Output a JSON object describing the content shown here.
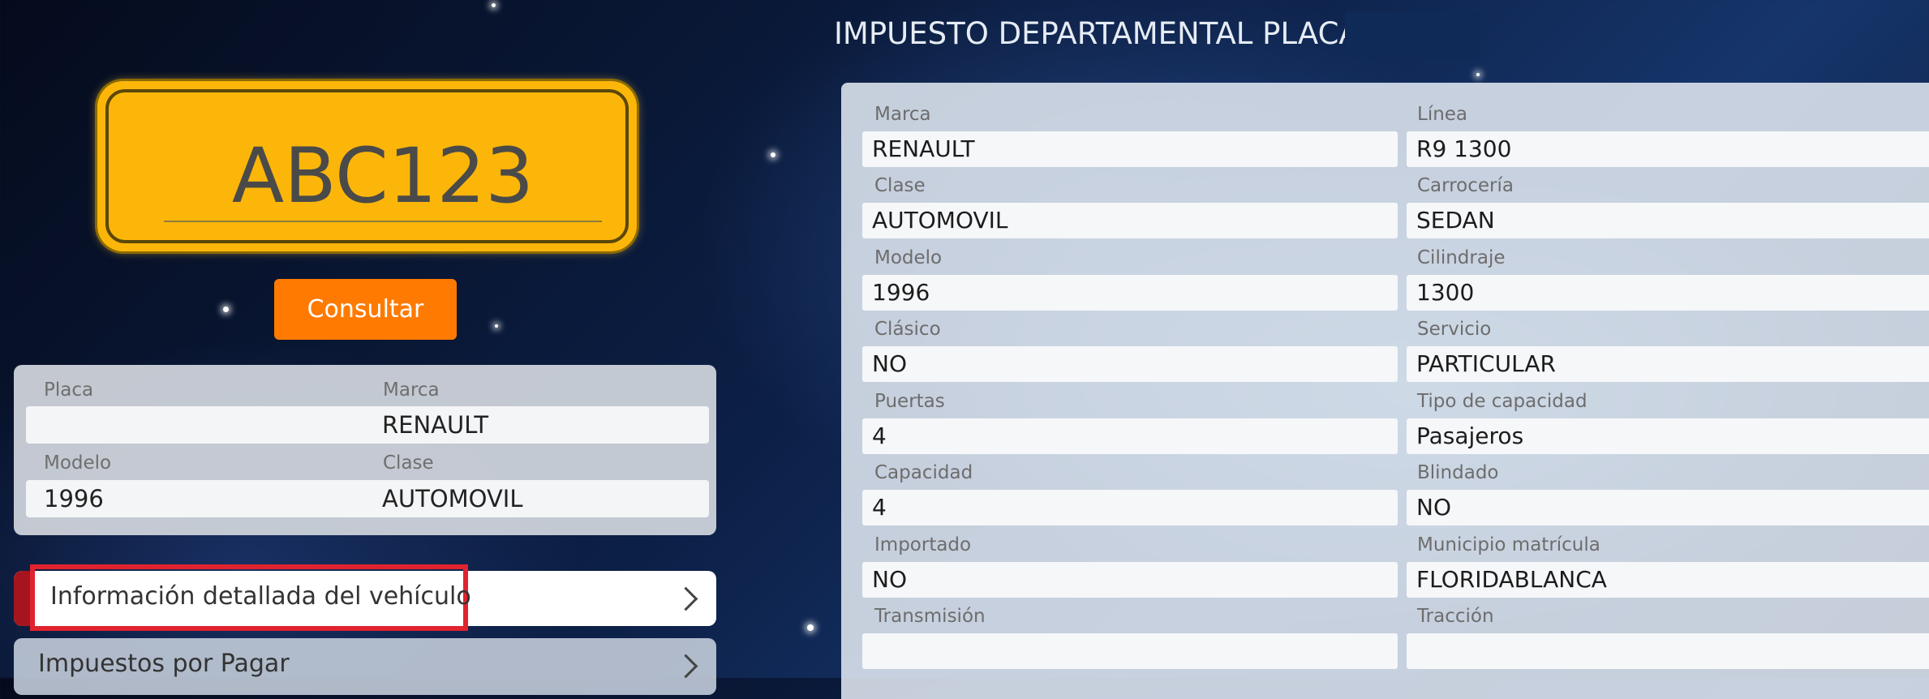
{
  "plate": {
    "value": "ABC123"
  },
  "consultar_label": "Consultar",
  "summary": {
    "placa": {
      "label": "Placa",
      "value": ""
    },
    "marca": {
      "label": "Marca",
      "value": "RENAULT"
    },
    "modelo": {
      "label": "Modelo",
      "value": "1996"
    },
    "clase": {
      "label": "Clase",
      "value": "AUTOMOVIL"
    }
  },
  "accordion": {
    "detailed_info": "Información detallada del vehículo",
    "taxes_due": "Impuestos por Pagar"
  },
  "right_panel": {
    "title": "IMPUESTO DEPARTAMENTAL PLACA",
    "fields": [
      {
        "label": "Marca",
        "value": "RENAULT"
      },
      {
        "label": "Línea",
        "value": "R9 1300"
      },
      {
        "label": "Clase",
        "value": "AUTOMOVIL"
      },
      {
        "label": "Carrocería",
        "value": "SEDAN"
      },
      {
        "label": "Modelo",
        "value": "1996"
      },
      {
        "label": "Cilindraje",
        "value": "1300"
      },
      {
        "label": "Clásico",
        "value": "NO"
      },
      {
        "label": "Servicio",
        "value": "PARTICULAR"
      },
      {
        "label": "Puertas",
        "value": "4"
      },
      {
        "label": "Tipo de capacidad",
        "value": "Pasajeros"
      },
      {
        "label": "Capacidad",
        "value": "4"
      },
      {
        "label": "Blindado",
        "value": "NO"
      },
      {
        "label": "Importado",
        "value": "NO"
      },
      {
        "label": "Municipio matrícula",
        "value": "FLORIDABLANCA"
      },
      {
        "label": "Transmisión",
        "value": ""
      },
      {
        "label": "Tracción",
        "value": ""
      }
    ]
  },
  "colors": {
    "plate": "#fcb60a",
    "consultar": "#ff7a00",
    "highlight": "#e0232e"
  },
  "icons": [
    "chevron-right-icon"
  ]
}
